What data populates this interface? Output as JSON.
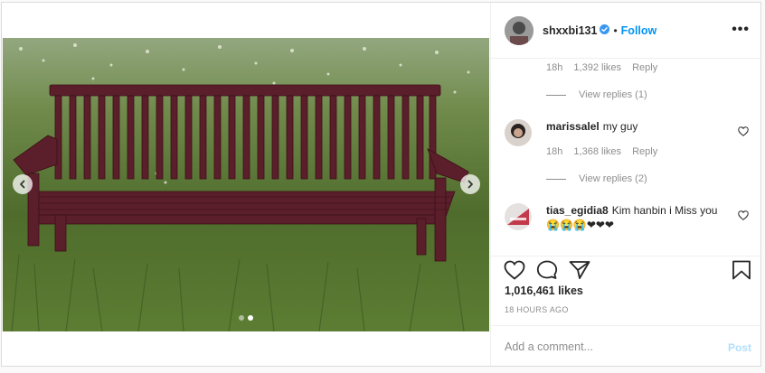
{
  "post": {
    "username": "shxxbi131",
    "separator": "•",
    "follow_label": "Follow",
    "more_label": "•••",
    "likes": "1,016,461 likes",
    "timestamp": "18 HOURS AGO",
    "carousel": {
      "slides": 2,
      "active_slide": 2
    }
  },
  "thread": {
    "top_meta": {
      "time": "18h",
      "likes": "1,392 likes",
      "reply": "Reply"
    },
    "top_view_replies": "View replies (1)",
    "comments": [
      {
        "username": "marissalel",
        "text": "my guy",
        "time": "18h",
        "likes": "1,368 likes",
        "reply": "Reply",
        "view_replies": "View replies (2)"
      },
      {
        "username": "tias_egidia8",
        "text": "Kim hanbin i Miss you😭😭😭❤❤❤"
      }
    ]
  },
  "composer": {
    "placeholder": "Add a comment...",
    "post_label": "Post"
  },
  "colors": {
    "accent": "#0095f6",
    "post_disabled": "#b2dffc",
    "muted": "#8e8e8e"
  },
  "icons": [
    "verified-badge-icon",
    "more-options-icon",
    "chevron-left-icon",
    "chevron-right-icon",
    "heart-icon",
    "comment-icon",
    "share-icon",
    "bookmark-icon"
  ]
}
